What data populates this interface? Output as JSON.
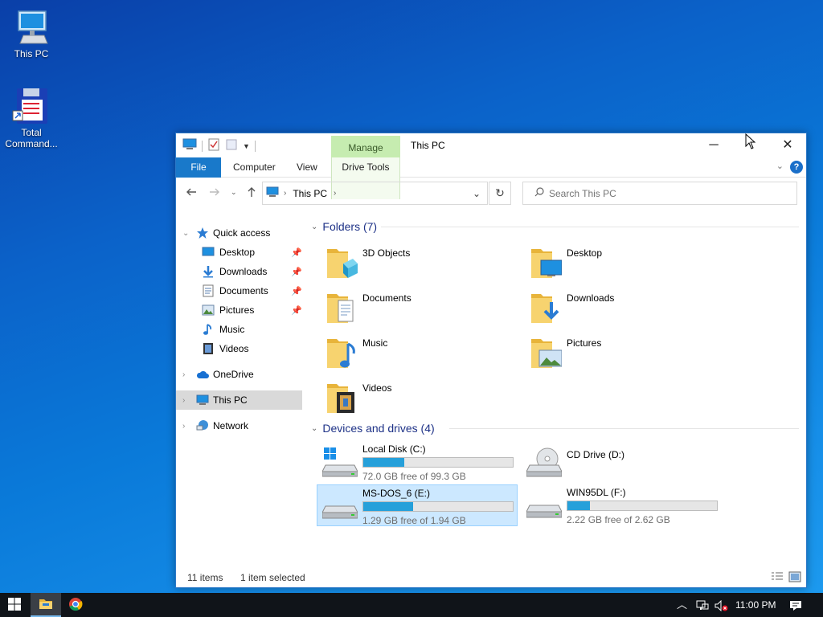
{
  "desktop": {
    "icons": [
      {
        "label": "This PC"
      },
      {
        "label": "Total Command..."
      }
    ]
  },
  "window": {
    "title": "This PC",
    "manage_tab": "Manage",
    "ribbon_tabs": [
      "File",
      "Computer",
      "View",
      "Drive Tools"
    ],
    "minimize": "─",
    "close": "✕",
    "help": "?"
  },
  "address": {
    "path": "This PC",
    "search_placeholder": "Search This PC"
  },
  "nav_pane": {
    "quick_access": "Quick access",
    "quick_items": [
      {
        "label": "Desktop",
        "icon": "desktop-icon",
        "pinned": true
      },
      {
        "label": "Downloads",
        "icon": "downloads-icon",
        "pinned": true
      },
      {
        "label": "Documents",
        "icon": "documents-icon",
        "pinned": true
      },
      {
        "label": "Pictures",
        "icon": "pictures-icon",
        "pinned": true
      },
      {
        "label": "Music",
        "icon": "music-icon",
        "pinned": false
      },
      {
        "label": "Videos",
        "icon": "videos-icon",
        "pinned": false
      }
    ],
    "onedrive": "OneDrive",
    "this_pc": "This PC",
    "network": "Network"
  },
  "folders": {
    "header": "Folders (7)",
    "items": [
      {
        "label": "3D Objects",
        "icon": "3d-objects-folder-icon"
      },
      {
        "label": "Desktop",
        "icon": "desktop-folder-icon"
      },
      {
        "label": "Documents",
        "icon": "documents-folder-icon"
      },
      {
        "label": "Downloads",
        "icon": "downloads-folder-icon"
      },
      {
        "label": "Music",
        "icon": "music-folder-icon"
      },
      {
        "label": "Pictures",
        "icon": "pictures-folder-icon"
      },
      {
        "label": "Videos",
        "icon": "videos-folder-icon"
      }
    ]
  },
  "drives": {
    "header": "Devices and drives (4)",
    "items": [
      {
        "label": "Local Disk (C:)",
        "free_text": "72.0 GB free of 99.3 GB",
        "used_fraction": 0.275,
        "type": "disk"
      },
      {
        "label": "CD Drive (D:)",
        "type": "cd"
      },
      {
        "label": "MS-DOS_6 (E:)",
        "free_text": "1.29 GB free of 1.94 GB",
        "used_fraction": 0.335,
        "type": "disk",
        "selected": true
      },
      {
        "label": "WIN95DL (F:)",
        "free_text": "2.22 GB free of 2.62 GB",
        "used_fraction": 0.153,
        "type": "disk"
      }
    ]
  },
  "status": {
    "items_count": "11 items",
    "selected": "1 item selected"
  },
  "taskbar": {
    "clock": "11:00 PM"
  },
  "colors": {
    "accent": "#1979ca",
    "drive_fill": "#26a0da",
    "manage_tab": "#c6ecb0",
    "selection": "#cce8ff"
  }
}
